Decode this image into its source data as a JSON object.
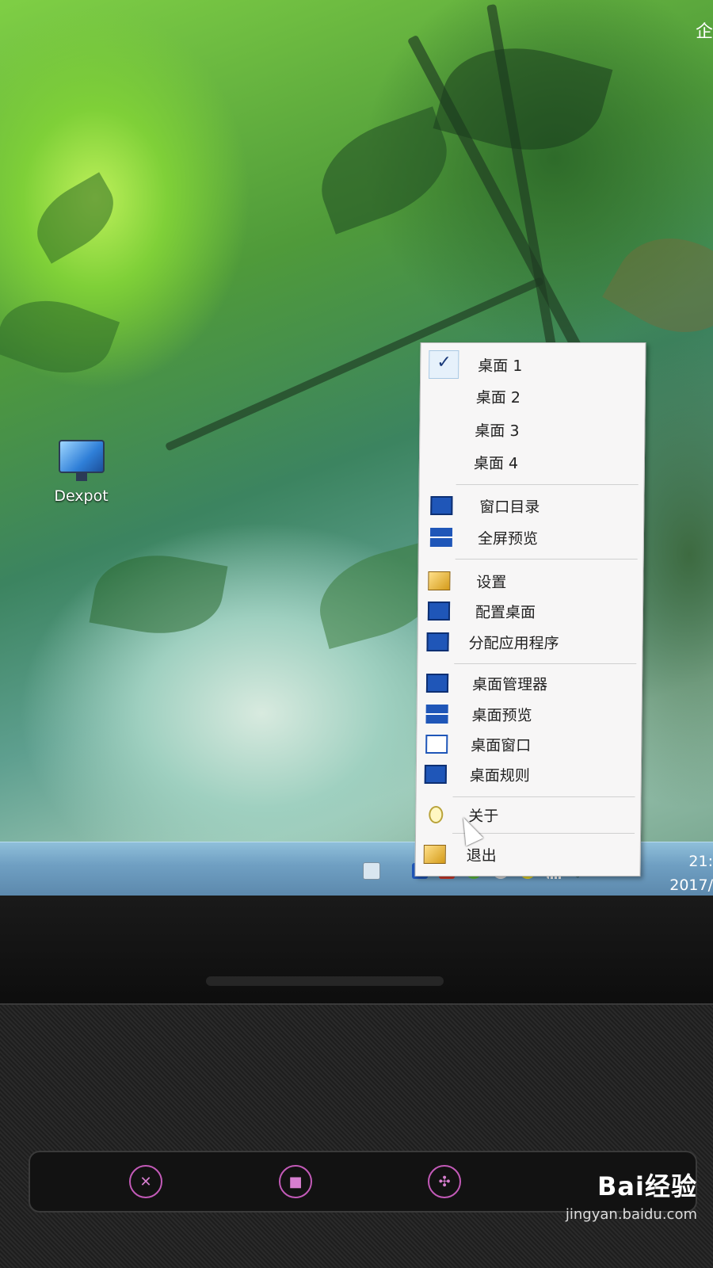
{
  "screen": {
    "top_right_text": "企"
  },
  "desktop": {
    "icon_label": "Dexpot"
  },
  "menu": {
    "desktops": [
      {
        "label": "桌面 1",
        "checked": true
      },
      {
        "label": "桌面 2",
        "checked": false
      },
      {
        "label": "桌面 3",
        "checked": false
      },
      {
        "label": "桌面 4",
        "checked": false
      }
    ],
    "check_mark": "✓",
    "group1": [
      {
        "label": "窗口目录",
        "icon": "window-catalog-icon"
      },
      {
        "label": "全屏预览",
        "icon": "fullscreen-preview-icon"
      }
    ],
    "group2": [
      {
        "label": "设置",
        "icon": "settings-icon"
      },
      {
        "label": "配置桌面",
        "icon": "configure-desktop-icon"
      },
      {
        "label": "分配应用程序",
        "icon": "assign-app-icon"
      }
    ],
    "group3": [
      {
        "label": "桌面管理器",
        "icon": "desktop-manager-icon"
      },
      {
        "label": "桌面预览",
        "icon": "desktop-preview-icon"
      },
      {
        "label": "桌面窗口",
        "icon": "desktop-window-icon"
      },
      {
        "label": "桌面规则",
        "icon": "desktop-rules-icon"
      }
    ],
    "group4": [
      {
        "label": "关于",
        "icon": "bulb-icon"
      },
      {
        "label": "退出",
        "icon": "exit-icon"
      }
    ]
  },
  "taskbar": {
    "clock_time": "21:",
    "clock_date": "2017/"
  },
  "watermark": {
    "brand": "Bai经验",
    "url": "jingyan.baidu.com"
  },
  "colors": {
    "menu_bg": "#f7f6f6",
    "icon_blue": "#1f56b8",
    "taskbar": "#6f9fc2",
    "hw_button": "#c35ab8"
  }
}
